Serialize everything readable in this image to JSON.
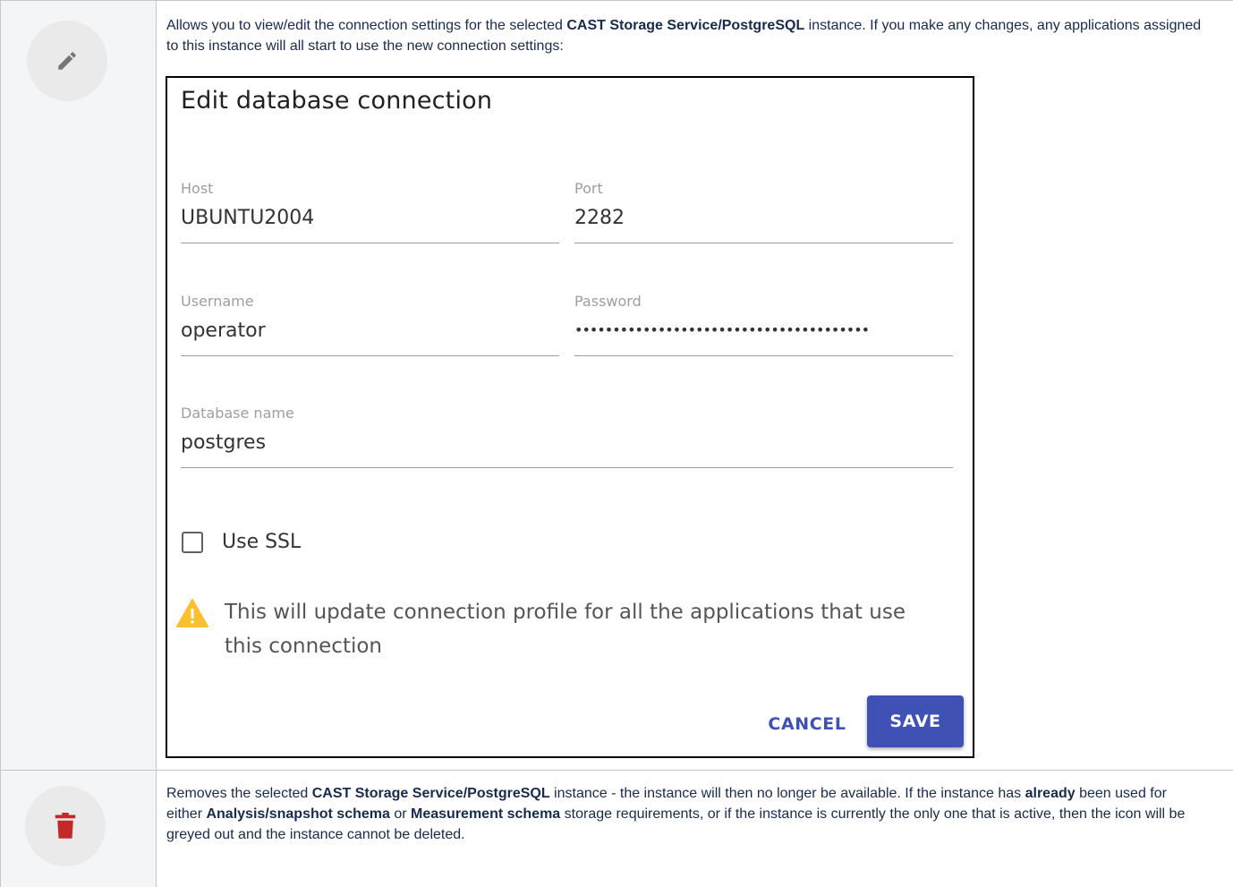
{
  "rows": [
    {
      "icon": "pencil-icon",
      "description": {
        "part1": "Allows you to view/edit the connection settings for the selected ",
        "bold1": "CAST Storage Service/PostgreSQL",
        "part2": " instance. If you make any changes, any applications assigned to this instance will all start to use the new connection settings:"
      }
    },
    {
      "icon": "trash-icon",
      "description": {
        "part1": "Removes the selected ",
        "bold1": "CAST Storage Service/PostgreSQL",
        "part2": " instance - the instance will then no longer be available. If the instance has ",
        "bold2": "already",
        "part3": " been used for either ",
        "bold3": "Analysis/snapshot schema",
        "part4": " or ",
        "bold4": "Measurement schema",
        "part5": " storage requirements, or if the instance is currently the only one that is active, then the icon will be greyed out and the instance cannot be deleted."
      }
    }
  ],
  "dialog": {
    "title": "Edit database connection",
    "host": {
      "label": "Host",
      "value": "UBUNTU2004"
    },
    "port": {
      "label": "Port",
      "value": "2282"
    },
    "username": {
      "label": "Username",
      "value": "operator"
    },
    "password": {
      "label": "Password",
      "value": "•••••••••••••••••••••••••••••••••••••••"
    },
    "database": {
      "label": "Database name",
      "value": "postgres"
    },
    "ssl_label": "Use SSL",
    "ssl_checked": false,
    "warning": "This will update connection profile for all the applications that use this connection",
    "cancel_label": "CANCEL",
    "save_label": "SAVE"
  },
  "colors": {
    "accent": "#3f51b5",
    "warning": "#fbc02d",
    "delete_icon": "#c62828",
    "icon_cell_bg": "#f4f5f7"
  }
}
